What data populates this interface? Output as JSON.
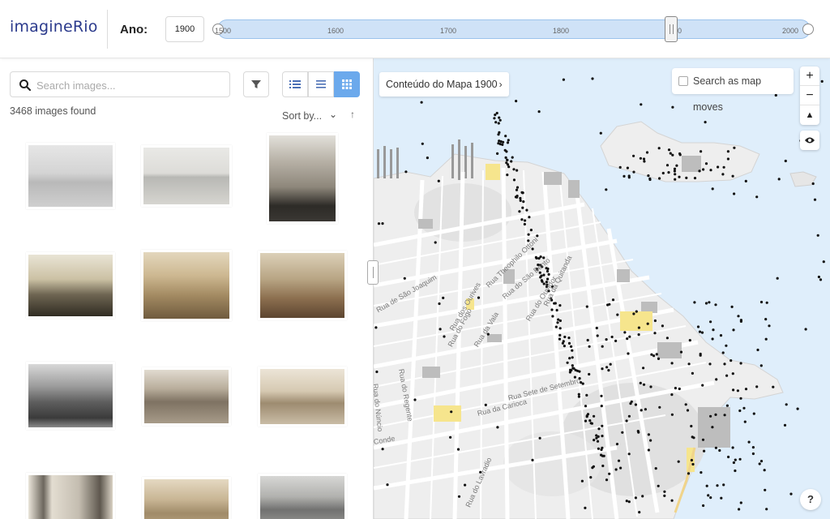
{
  "header": {
    "logo_main": "imagine",
    "logo_accent": "Rio",
    "year_label": "Ano:",
    "year_value": "1900",
    "timeline_ticks": [
      "1500",
      "1600",
      "1700",
      "1800",
      "1900",
      "2000"
    ],
    "timeline_selected": "1900"
  },
  "panel": {
    "search_placeholder": "Search images...",
    "count_text": "3468 images found",
    "sort_label": "Sort by...",
    "sort_chevron": "⌄",
    "sort_direction": "↑",
    "view_modes": [
      "list-detailed",
      "list",
      "grid"
    ],
    "active_view": "grid"
  },
  "map": {
    "content_label": "Conteúdo do Mapa 1900",
    "content_chevron": "›",
    "search_as_moves": "Search as map moves",
    "zoom_in": "+",
    "zoom_out": "−",
    "compass": "▲",
    "help": "?",
    "streets": [
      "Rua Theophilo Ottoni",
      "Rua do São Bento",
      "Rua da Quitanda",
      "Rua do Ouvidor",
      "Rua de São Joaquim",
      "Rua dos Ourives",
      "Rua da Vala",
      "Rua do Fogo",
      "Rua Sete de Setembro",
      "Rua da Carioca",
      "Rua do Regente",
      "Rua do Núncio",
      "Rua do Lavradio",
      "Conde"
    ]
  },
  "colors": {
    "accent": "#6ba9ec",
    "brand": "#2b3a8c",
    "timeline_fill": "#cfe2f7",
    "water": "#dfeefb",
    "land": "#f0f0f0"
  }
}
